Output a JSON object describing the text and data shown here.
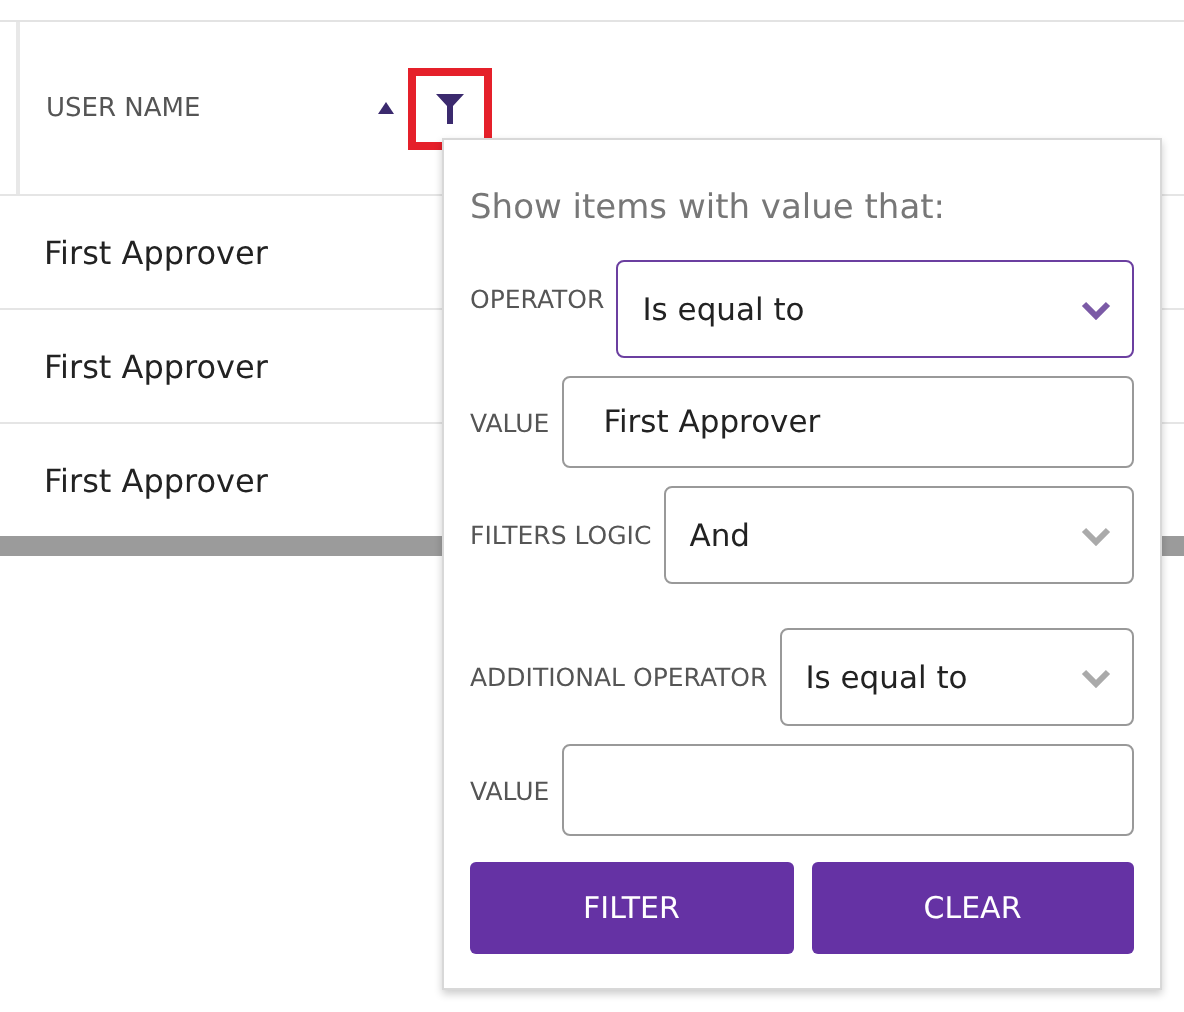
{
  "grid": {
    "column": {
      "title": "USER NAME",
      "sorted_ascending": true,
      "filter_highlighted": true
    },
    "rows": [
      {
        "user_name": "First Approver"
      },
      {
        "user_name": "First Approver"
      },
      {
        "user_name": "First Approver"
      }
    ]
  },
  "filter_menu": {
    "heading": "Show items with value that:",
    "fields": [
      {
        "kind": "select",
        "label": "OPERATOR",
        "value": "Is equal to",
        "focused": true
      },
      {
        "kind": "text",
        "label": "VALUE",
        "value": "First Approver",
        "focused": false
      },
      {
        "kind": "select",
        "label": "FILTERS LOGIC",
        "value": "And",
        "focused": false
      },
      {
        "kind": "select",
        "label": "ADDITIONAL OPERATOR",
        "value": "Is equal to",
        "focused": false
      },
      {
        "kind": "text",
        "label": "VALUE",
        "focused": false
      }
    ],
    "buttons": [
      "FILTER",
      "CLEAR"
    ]
  }
}
